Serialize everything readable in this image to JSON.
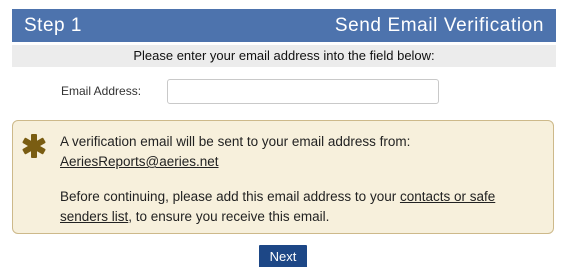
{
  "header": {
    "step": "Step 1",
    "title": "Send Email Verification"
  },
  "instructions": "Please enter your email address into the field below:",
  "email_field": {
    "label": "Email Address:",
    "value": "",
    "placeholder": ""
  },
  "notice": {
    "icon": "asterisk-icon",
    "line1": "A verification email will be sent to your email address from:",
    "from_email": "AeriesReports@aeries.net",
    "line2_before": "Before continuing, please add this email address to your ",
    "line2_link": "contacts or safe senders list",
    "line2_after": ", to ensure you receive this email."
  },
  "next_button": "Next",
  "colors": {
    "header_bg": "#4d73ad",
    "instructions_bg": "#ececec",
    "notice_bg": "#f7f0dc",
    "notice_border": "#cdb98a",
    "asterisk": "#7a5d12",
    "button_bg": "#1d4786"
  }
}
